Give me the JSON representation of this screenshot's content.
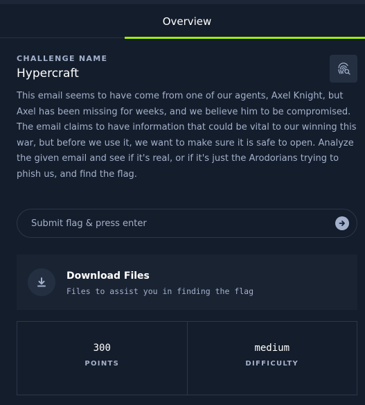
{
  "tabs": {
    "overview_label": "Overview"
  },
  "challenge": {
    "section_label": "CHALLENGE NAME",
    "name": "Hypercraft",
    "description": "This email seems to have come from one of our agents, Axel Knight, but Axel has been missing for weeks, and we believe him to be compromised. The email claims to have information that could be vital to our winning this war, but before we use it, we want to make sure it is safe to open. Analyze the given email and see if it's real, or if it's just the Arodorians trying to phish us, and find the flag."
  },
  "flag_input": {
    "value": "",
    "placeholder": "Submit flag & press enter"
  },
  "download": {
    "title": "Download Files",
    "subtitle": "Files to assist you in finding the flag"
  },
  "stats": {
    "points_value": "300",
    "points_label": "POINTS",
    "difficulty_value": "medium",
    "difficulty_label": "DIFFICULTY"
  },
  "icons": {
    "fingerprint_button": "fingerprint-search-icon",
    "submit": "arrow-right-circle-icon",
    "download": "download-icon"
  },
  "colors": {
    "background": "#141d2b",
    "accent": "#9fef00",
    "card": "#1a2332",
    "muted_text": "#a4b1cd"
  }
}
